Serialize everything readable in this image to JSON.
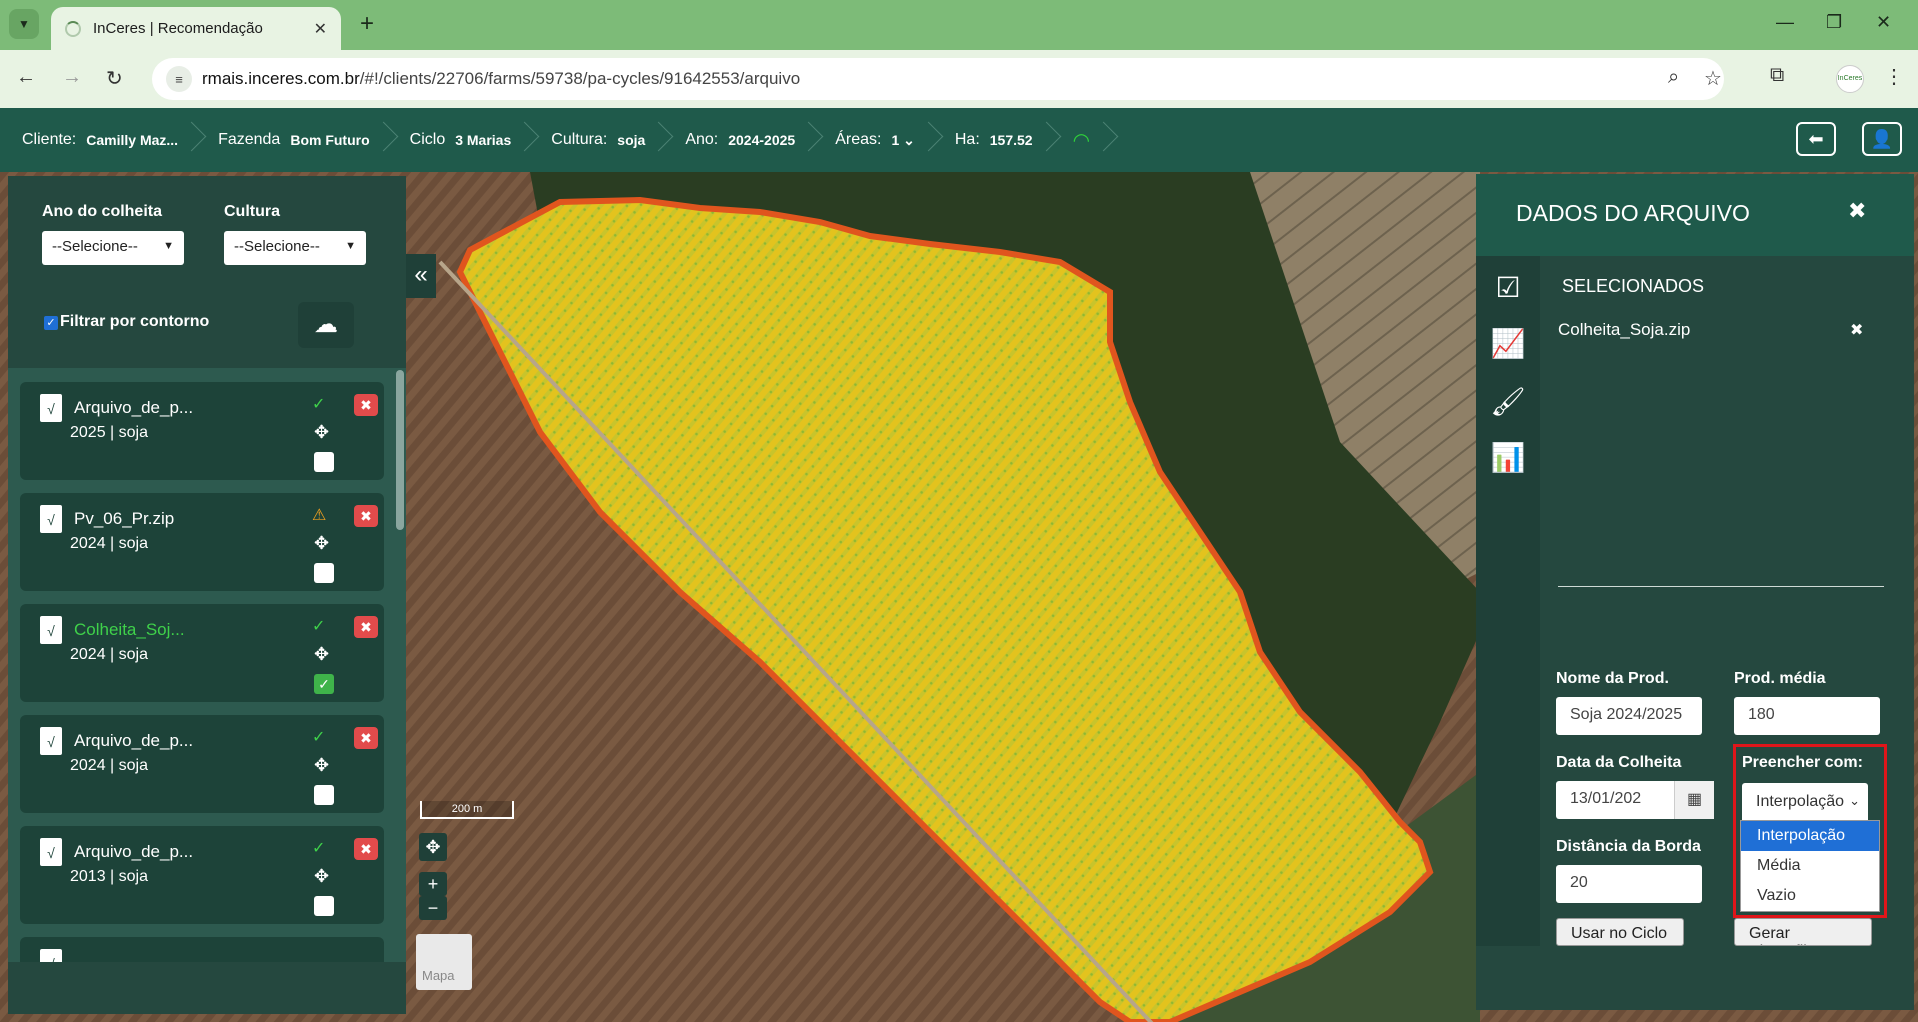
{
  "browser": {
    "tab_title": "InCeres | Recomendação",
    "url_host": "rmais.inceres.com.br",
    "url_path": "/#!/clients/22706/farms/59738/pa-cycles/91642553/arquivo",
    "profile_label": "InCeres"
  },
  "header": {
    "breadcrumbs": [
      {
        "label": "Cliente:",
        "value": "Camilly Maz..."
      },
      {
        "label": "Fazenda",
        "value": "Bom Futuro"
      },
      {
        "label": "Ciclo",
        "value": "3 Marias"
      },
      {
        "label": "Cultura:",
        "value": "soja"
      },
      {
        "label": "Ano:",
        "value": "2024-2025"
      },
      {
        "label": "Áreas:",
        "value": "1"
      },
      {
        "label": "Ha:",
        "value": "157.52"
      }
    ]
  },
  "left_panel": {
    "harvest_year_label": "Ano do colheita",
    "harvest_year_value": "--Selecione--",
    "culture_label": "Cultura",
    "culture_value": "--Selecione--",
    "filter_label": "Filtrar por contorno",
    "files": [
      {
        "name": "Arquivo_de_p...",
        "sub": "2025 | soja",
        "status": "ok",
        "checked": false
      },
      {
        "name": "Pv_06_Pr.zip",
        "sub": "2024 | soja",
        "status": "warn",
        "checked": false
      },
      {
        "name": "Colheita_Soj...",
        "sub": "2024 | soja",
        "status": "ok",
        "checked": true
      },
      {
        "name": "Arquivo_de_p...",
        "sub": "2024 | soja",
        "status": "ok",
        "checked": false
      },
      {
        "name": "Arquivo_de_p...",
        "sub": "2013 | soja",
        "status": "ok",
        "checked": false
      }
    ]
  },
  "map": {
    "scale_label": "200 m",
    "zoom_in": "+",
    "zoom_out": "−",
    "minimap_label": "Mapa"
  },
  "right_panel": {
    "title": "DADOS DO ARQUIVO",
    "section": "SELECIONADOS",
    "selected_file": "Colheita_Soja.zip",
    "prod_name_label": "Nome da Prod.",
    "prod_name_value": "Soja 2024/2025",
    "prod_avg_label": "Prod. média",
    "prod_avg_value": "180",
    "harvest_date_label": "Data da Colheita",
    "harvest_date_value": "13/01/202",
    "fill_label": "Preencher com:",
    "fill_value": "Interpolação",
    "fill_options": [
      "Interpolação",
      "Média",
      "Vazio"
    ],
    "edge_label": "Distância da Borda",
    "edge_value": "20",
    "use_button": "Usar no Ciclo",
    "shapefile_button": "Gerar Shapefile"
  },
  "colors": {
    "header_bg": "#1f5a4b",
    "panel_bg": "#25483f",
    "accent_green": "#3fd14a",
    "danger": "#e24b4b",
    "highlight": "#e0161a"
  }
}
